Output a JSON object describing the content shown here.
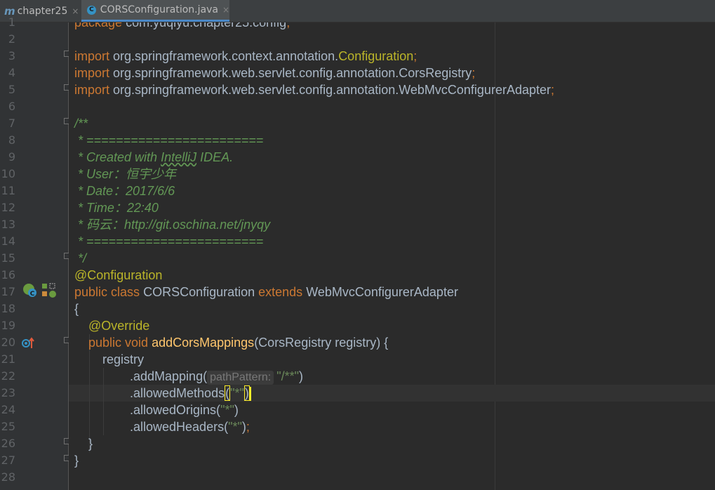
{
  "tabs": [
    {
      "icon": "maven-module-icon",
      "label": "chapter25",
      "close": "×"
    },
    {
      "icon": "java-class-icon",
      "label": "CORSConfiguration.java",
      "close": "×"
    }
  ],
  "line_numbers": [
    "1",
    "2",
    "3",
    "4",
    "5",
    "6",
    "7",
    "8",
    "9",
    "10",
    "11",
    "12",
    "13",
    "14",
    "15",
    "16",
    "17",
    "18",
    "19",
    "20",
    "21",
    "22",
    "23",
    "24",
    "25",
    "26",
    "27",
    "28"
  ],
  "code": {
    "l1": {
      "kw": "package",
      "rest": " com.yuqiyu.chapter25.config",
      "semi": ";"
    },
    "l3": {
      "kw": "import",
      "pkg": " org.springframework.context.annotation.",
      "cls": "Configuration",
      "semi": ";"
    },
    "l4": {
      "kw": "import",
      "pkg": " org.springframework.web.servlet.config.annotation.CorsRegistry",
      "semi": ";"
    },
    "l5": {
      "kw": "import",
      "pkg": " org.springframework.web.servlet.config.annotation.WebMvcConfigurerAdapter",
      "semi": ";"
    },
    "l7": "/**",
    "l8": " * ========================",
    "l9a": " * Created with ",
    "l9b": "IntelliJ",
    "l9c": " IDEA.",
    "l10": " * User：恒宇少年",
    "l11": " * Date：2017/6/6",
    "l12": " * Time：22:40",
    "l13": " * 码云：http://git.oschina.net/jnyqy",
    "l14": " * ========================",
    "l15": " */",
    "l16": "@Configuration",
    "l17": {
      "kw1": "public",
      "kw2": "class",
      "name": " CORSConfiguration ",
      "kw3": "extends",
      "parent": " WebMvcConfigurerAdapter"
    },
    "l18": "{",
    "l19": "@Override",
    "l20": {
      "kw1": "public",
      "kw2": "void",
      "fn": "addCorsMappings",
      "params": "(CorsRegistry registry) {"
    },
    "l21": "registry",
    "l22": {
      "call": ".addMapping(",
      "hint": "pathPattern:",
      "str": "\"/**\"",
      "end": ")"
    },
    "l23": {
      "call": ".allowedMethods",
      "open": "(",
      "str": "\"*\"",
      "close": ")"
    },
    "l24": {
      "call": ".allowedOrigins(",
      "str": "\"*\"",
      "end": ")"
    },
    "l25": {
      "call": ".allowedHeaders(",
      "str": "\"*\"",
      "end": ")",
      "semi": ";"
    },
    "l26": "}",
    "l27": "}"
  },
  "gutter_icons": [
    "spring-bean-icon",
    "class-hierarchy-icon",
    "override-method-icon"
  ],
  "colors": {
    "keyword": "#cc7832",
    "annotation": "#bbb529",
    "function": "#ffc66d",
    "string": "#6a8759",
    "comment": "#629755",
    "text": "#a9b7c6"
  }
}
